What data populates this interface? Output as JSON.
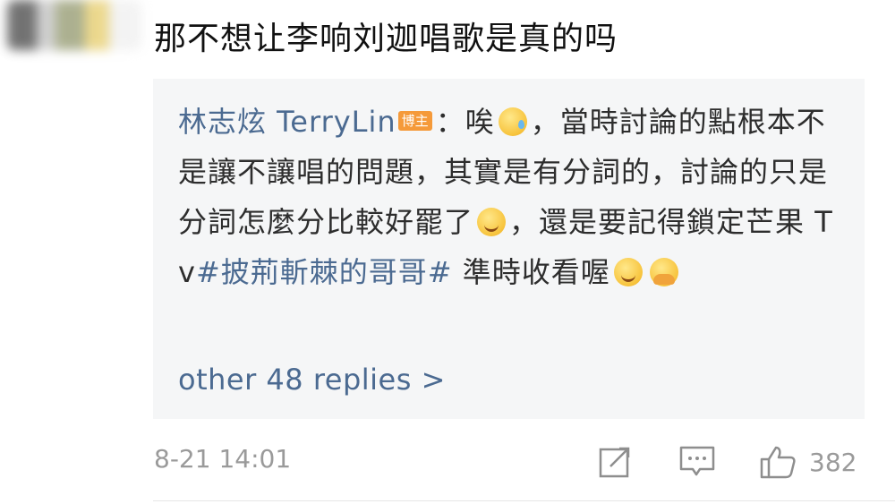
{
  "comment": {
    "text": "那不想让李响刘迦唱歌是真的吗"
  },
  "reply": {
    "author": "林志炫 TerryLin",
    "badge": "博主",
    "segment1": "：唉",
    "segment2": "，當時討論的點根本不是讓不讓唱的問題，其實是有分詞的，討論的只是分詞怎麼分比較好罷了",
    "segment3": "，還是要記得鎖定芒果 Tv",
    "hashtag": "#披荊斬棘的哥哥#",
    "segment4": " 準時收看喔",
    "emojis": [
      "sweat-emoji",
      "smile-emoji",
      "smile-emoji",
      "cover-mouth-emoji"
    ]
  },
  "more_replies": "other 48 replies >",
  "footer": {
    "time": "8-21 14:01",
    "likes": "382",
    "icons": [
      "share-icon",
      "comment-icon",
      "like-icon"
    ]
  },
  "colors": {
    "link": "#4b6a91",
    "badge": "#f59a3a",
    "reply_bg": "#f5f6f7",
    "meta": "#9a9a9a"
  }
}
